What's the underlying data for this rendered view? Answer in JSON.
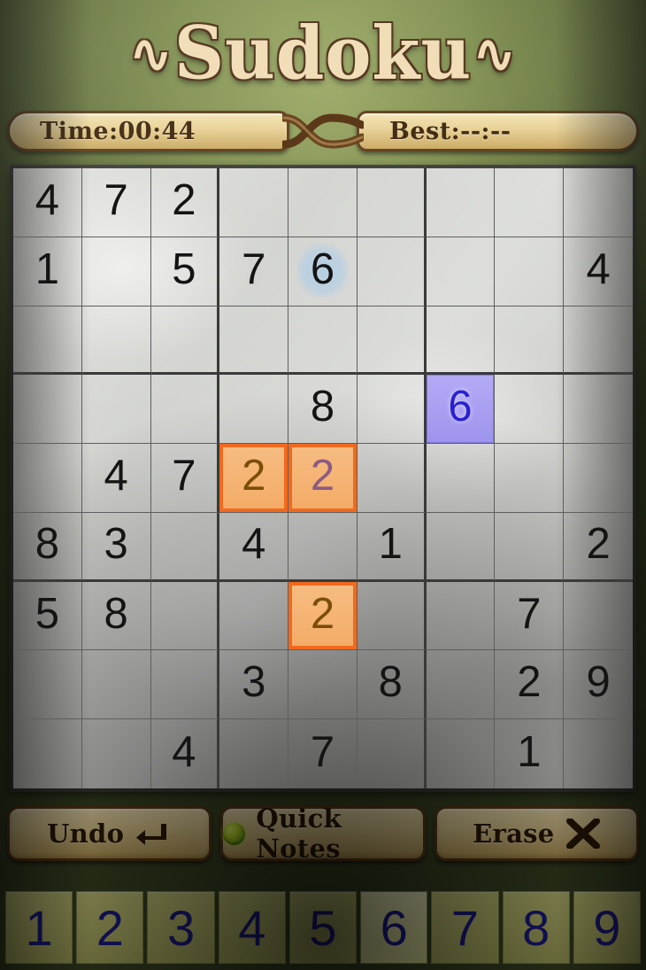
{
  "header": {
    "title": "Sudoku",
    "flourish_left": "∿",
    "flourish_right": "∿"
  },
  "status": {
    "time_label": "Time:",
    "time_value": "00:44",
    "best_label": "Best:",
    "best_value": "--:--"
  },
  "board": {
    "cells": [
      [
        {
          "v": "4"
        },
        {
          "v": "7"
        },
        {
          "v": "2"
        },
        {
          "v": ""
        },
        {
          "v": ""
        },
        {
          "v": ""
        },
        {
          "v": ""
        },
        {
          "v": ""
        },
        {
          "v": ""
        }
      ],
      [
        {
          "v": "1"
        },
        {
          "v": ""
        },
        {
          "v": "5"
        },
        {
          "v": "7"
        },
        {
          "v": "6",
          "hl": "soft"
        },
        {
          "v": ""
        },
        {
          "v": ""
        },
        {
          "v": ""
        },
        {
          "v": "4"
        }
      ],
      [
        {
          "v": ""
        },
        {
          "v": ""
        },
        {
          "v": ""
        },
        {
          "v": ""
        },
        {
          "v": ""
        },
        {
          "v": ""
        },
        {
          "v": ""
        },
        {
          "v": ""
        },
        {
          "v": ""
        }
      ],
      [
        {
          "v": ""
        },
        {
          "v": ""
        },
        {
          "v": ""
        },
        {
          "v": ""
        },
        {
          "v": "8"
        },
        {
          "v": ""
        },
        {
          "v": "6",
          "hl": "select"
        },
        {
          "v": ""
        },
        {
          "v": ""
        }
      ],
      [
        {
          "v": ""
        },
        {
          "v": "4"
        },
        {
          "v": "7"
        },
        {
          "v": "2",
          "hl": "orange"
        },
        {
          "v": "2",
          "hl": "orange",
          "tone": "purple"
        },
        {
          "v": ""
        },
        {
          "v": ""
        },
        {
          "v": ""
        },
        {
          "v": ""
        }
      ],
      [
        {
          "v": "8"
        },
        {
          "v": "3"
        },
        {
          "v": ""
        },
        {
          "v": "4"
        },
        {
          "v": ""
        },
        {
          "v": "1"
        },
        {
          "v": ""
        },
        {
          "v": ""
        },
        {
          "v": "2"
        }
      ],
      [
        {
          "v": "5"
        },
        {
          "v": "8"
        },
        {
          "v": ""
        },
        {
          "v": ""
        },
        {
          "v": "2",
          "hl": "orange"
        },
        {
          "v": ""
        },
        {
          "v": ""
        },
        {
          "v": "7"
        },
        {
          "v": ""
        }
      ],
      [
        {
          "v": ""
        },
        {
          "v": ""
        },
        {
          "v": ""
        },
        {
          "v": "3"
        },
        {
          "v": ""
        },
        {
          "v": "8"
        },
        {
          "v": ""
        },
        {
          "v": "2"
        },
        {
          "v": "9"
        }
      ],
      [
        {
          "v": ""
        },
        {
          "v": ""
        },
        {
          "v": "4"
        },
        {
          "v": ""
        },
        {
          "v": "7"
        },
        {
          "v": ""
        },
        {
          "v": ""
        },
        {
          "v": "1"
        },
        {
          "v": ""
        }
      ]
    ]
  },
  "actions": {
    "undo_label": "Undo",
    "undo_icon": "undo-arrow-icon",
    "quick_notes_label": "Quick Notes",
    "quick_notes_icon": "green-led-icon",
    "erase_label": "Erase",
    "erase_icon": "x-cross-icon"
  },
  "numpad": {
    "keys": [
      "1",
      "2",
      "3",
      "4",
      "5",
      "6",
      "7",
      "8",
      "9"
    ],
    "selected": "6"
  },
  "colors": {
    "highlight_orange_fill": "#f5b06a",
    "highlight_orange_border": "#f2691e",
    "selected_cell_fill": "#a9a0f0",
    "selected_cell_text": "#2a1fd0",
    "soft_hint_fill": "#b6cfe3",
    "numpad_text": "#1d1d8e",
    "numpad_selected_fill": "#f6f6bb",
    "plaque_text": "#3a2207"
  }
}
